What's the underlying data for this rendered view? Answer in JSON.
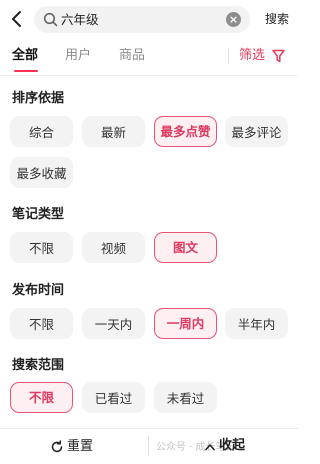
{
  "search": {
    "query": "六年级",
    "button_label": "搜索"
  },
  "tabs": [
    {
      "label": "全部"
    },
    {
      "label": "用户"
    },
    {
      "label": "商品"
    }
  ],
  "filter": {
    "label": "筛选"
  },
  "sections": {
    "sort": {
      "title": "排序依据",
      "options": [
        "综合",
        "最新",
        "最多点赞",
        "最多评论",
        "最多收藏"
      ],
      "selected": "最多点赞"
    },
    "note_type": {
      "title": "笔记类型",
      "options": [
        "不限",
        "视频",
        "图文"
      ],
      "selected": "图文"
    },
    "publish_time": {
      "title": "发布时间",
      "options": [
        "不限",
        "一天内",
        "一周内",
        "半年内"
      ],
      "selected": "一周内"
    },
    "search_scope": {
      "title": "搜索范围",
      "options": [
        "不限",
        "已看过",
        "未看过"
      ],
      "selected": "不限"
    }
  },
  "footer": {
    "reset_label": "重置",
    "collapse_label": "收起",
    "watermark": "公众号 · 成长笔记"
  },
  "colors": {
    "accent": "#e63a5e",
    "chip_bg": "#f3f3f3",
    "chip_selected_bg": "#fdeff2"
  }
}
